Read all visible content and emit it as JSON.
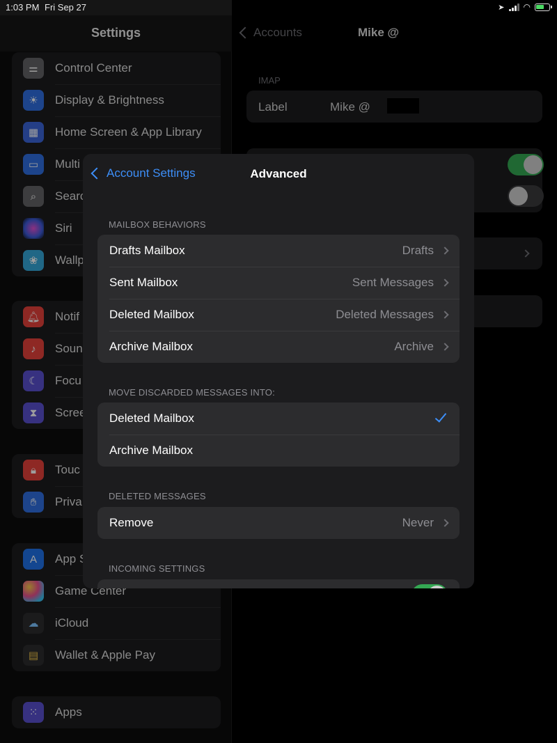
{
  "status_bar": {
    "time": "1:03 PM",
    "date": "Fri Sep 27"
  },
  "sidebar": {
    "title": "Settings",
    "groups": [
      {
        "items": [
          {
            "label": "Control Center",
            "icon": "switches-icon",
            "color": "#636366"
          },
          {
            "label": "Display & Brightness",
            "icon": "sun-icon",
            "color": "#2f6fe0"
          },
          {
            "label": "Home Screen & App Library",
            "icon": "grid-icon",
            "color": "#3a64d8"
          },
          {
            "label": "Multi",
            "icon": "multitasking-icon",
            "color": "#2f6fe0"
          },
          {
            "label": "Searc",
            "icon": "magnifier-icon",
            "color": "#636366"
          },
          {
            "label": "Siri",
            "icon": "siri-icon",
            "color": "#222"
          },
          {
            "label": "Wallp",
            "icon": "flower-icon",
            "color": "#35a7d8"
          }
        ]
      },
      {
        "items": [
          {
            "label": "Notif",
            "icon": "bell-icon",
            "color": "#e5413b"
          },
          {
            "label": "Soun",
            "icon": "speaker-icon",
            "color": "#e5413b"
          },
          {
            "label": "Focu",
            "icon": "moon-icon",
            "color": "#5a4fcf"
          },
          {
            "label": "Scree",
            "icon": "hourglass-icon",
            "color": "#5a4fcf"
          }
        ]
      },
      {
        "items": [
          {
            "label": "Touc",
            "icon": "lock-icon",
            "color": "#e5413b"
          },
          {
            "label": "Priva",
            "icon": "hand-icon",
            "color": "#2f6fe0"
          }
        ]
      },
      {
        "items": [
          {
            "label": "App S",
            "icon": "app-store-icon",
            "color": "#1f72e8"
          },
          {
            "label": "Game Center",
            "icon": "game-center-icon",
            "color": "#2c2c2e"
          },
          {
            "label": "iCloud",
            "icon": "cloud-icon",
            "color": "#2c2c2e"
          },
          {
            "label": "Wallet & Apple Pay",
            "icon": "wallet-icon",
            "color": "#2c2c2e"
          }
        ]
      },
      {
        "items": [
          {
            "label": "Apps",
            "icon": "apps-grid-icon",
            "color": "#5a4fcf"
          }
        ]
      }
    ]
  },
  "detail": {
    "back_label": "Accounts",
    "title": "Mike @",
    "section": "IMAP",
    "label_field": {
      "label": "Label",
      "value": "Mike @"
    }
  },
  "modal": {
    "back_label": "Account Settings",
    "title": "Advanced",
    "mailbox_behaviors": {
      "header": "MAILBOX BEHAVIORS",
      "rows": [
        {
          "label": "Drafts Mailbox",
          "value": "Drafts"
        },
        {
          "label": "Sent Mailbox",
          "value": "Sent Messages"
        },
        {
          "label": "Deleted Mailbox",
          "value": "Deleted Messages"
        },
        {
          "label": "Archive Mailbox",
          "value": "Archive"
        }
      ]
    },
    "discarded": {
      "header": "MOVE DISCARDED MESSAGES INTO:",
      "rows": [
        {
          "label": "Deleted Mailbox",
          "selected": true
        },
        {
          "label": "Archive Mailbox",
          "selected": false
        }
      ]
    },
    "deleted_messages": {
      "header": "DELETED MESSAGES",
      "rows": [
        {
          "label": "Remove",
          "value": "Never"
        }
      ]
    },
    "incoming": {
      "header": "INCOMING SETTINGS"
    }
  },
  "colors": {
    "accent": "#3d8ef7",
    "toggle_on": "#34a853"
  }
}
